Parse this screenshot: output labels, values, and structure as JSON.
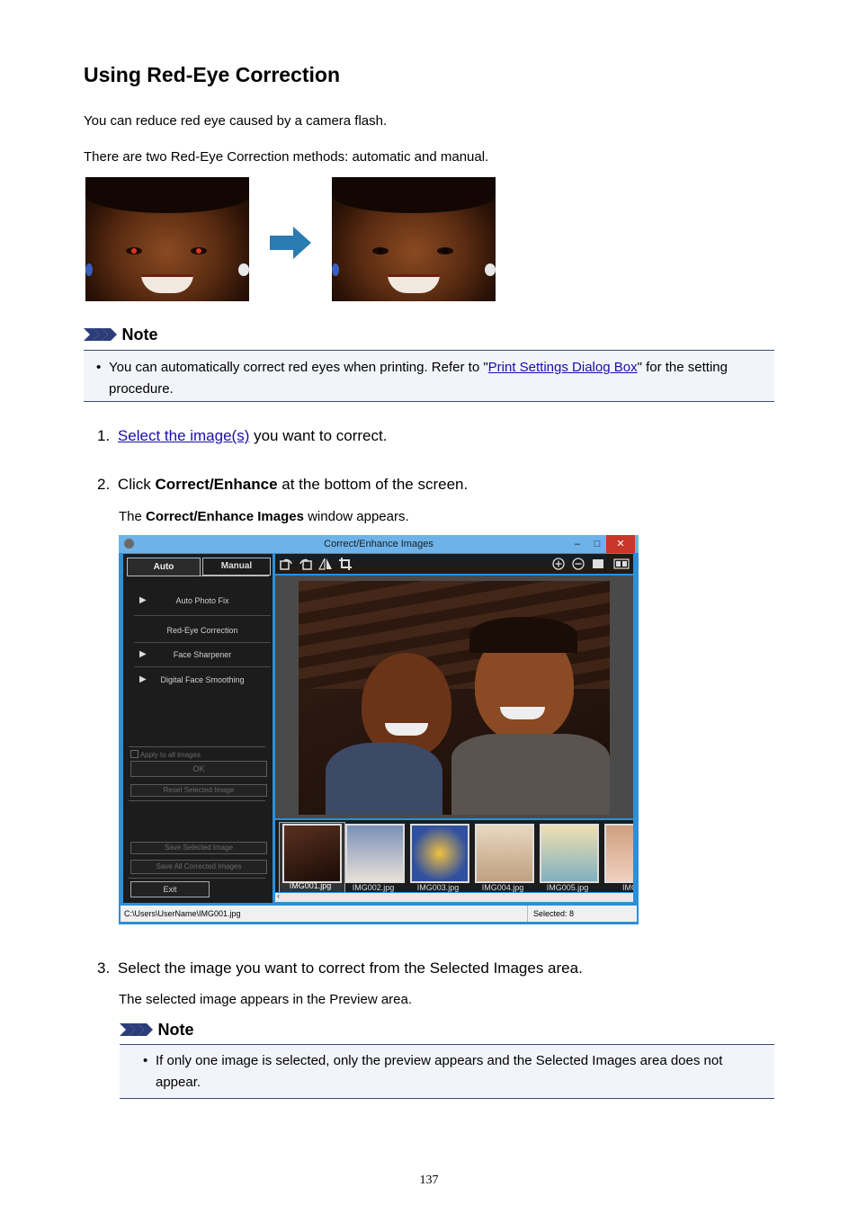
{
  "title": "Using Red-Eye Correction",
  "intro1": "You can reduce red eye caused by a camera flash.",
  "intro2": "There are two Red-Eye Correction methods: automatic and manual.",
  "note1": {
    "heading": "Note",
    "text_before": "You can automatically correct red eyes when printing. Refer to \"",
    "link": "Print Settings Dialog Box",
    "text_after": "\" for the setting procedure."
  },
  "steps": {
    "s1_num": "1.",
    "s1_link": "Select the image(s)",
    "s1_rest": " you want to correct.",
    "s2_num": "2.",
    "s2_pre": "Click ",
    "s2_bold": "Correct/Enhance",
    "s2_post": " at the bottom of the screen.",
    "s2_sub_pre": "The ",
    "s2_sub_bold": "Correct/Enhance Images",
    "s2_sub_post": " window appears.",
    "s3_num": "3.",
    "s3_text": "Select the image you want to correct from the Selected Images area.",
    "s3_sub": "The selected image appears in the Preview area."
  },
  "note2": {
    "heading": "Note",
    "text": "If only one image is selected, only the preview appears and the Selected Images area does not appear."
  },
  "window": {
    "title": "Correct/Enhance Images",
    "tab_auto": "Auto",
    "tab_manual": "Manual",
    "items": [
      "Auto Photo Fix",
      "Red-Eye Correction",
      "Face Sharpener",
      "Digital Face Smoothing"
    ],
    "apply_all": "Apply to all images",
    "ok": "OK",
    "reset": "Reset Selected Image",
    "save_selected": "Save Selected Image",
    "save_all": "Save All Corrected Images",
    "exit": "Exit",
    "thumbs": [
      "IMG001.jpg",
      "IMG002.jpg",
      "IMG003.jpg",
      "IMG004.jpg",
      "IMG005.jpg",
      "IMG0"
    ],
    "path": "C:\\Users\\UserName\\IMG001.jpg",
    "selected": "Selected: 8",
    "minimize": "–",
    "maximize": "□",
    "close": "✕"
  },
  "page_number": "137",
  "colors": {
    "link": "#1a0dab",
    "arrow": "#2b7bb3",
    "note_rule": "#3a4a7a",
    "window_frame": "#2c8fd8",
    "red_eye": "#d92a12"
  },
  "icons": [
    "arrow-right-icon",
    "note-chevrons-icon",
    "play-icon",
    "zoom-in-icon",
    "zoom-out-icon",
    "full-screen-icon",
    "compare-icon",
    "rotate-left-icon",
    "rotate-right-icon",
    "flip-icon",
    "crop-icon",
    "app-logo-icon"
  ]
}
